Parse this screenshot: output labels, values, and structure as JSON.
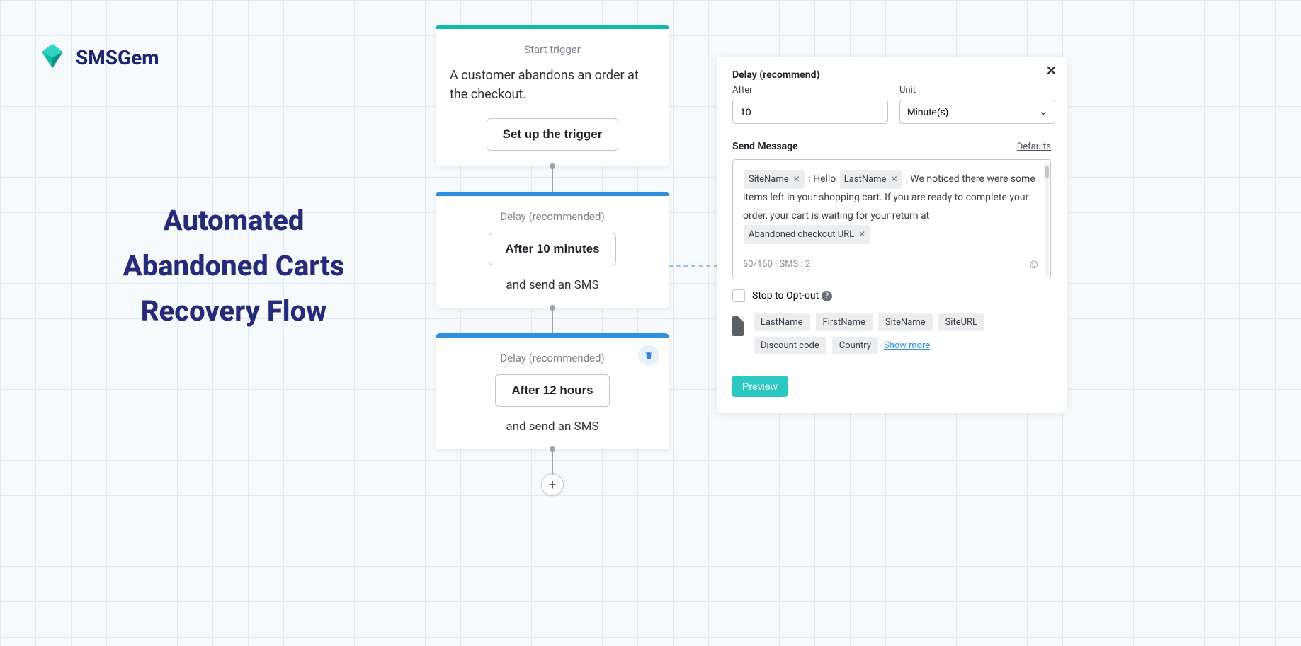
{
  "brand": {
    "name": "SMSGem"
  },
  "headline": {
    "line1": "Automated",
    "line2": "Abandoned Carts",
    "line3": "Recovery Flow"
  },
  "flow": {
    "trigger": {
      "label": "Start trigger",
      "description": "A customer abandons an order at the checkout.",
      "button": "Set up the trigger"
    },
    "delay1": {
      "label": "Delay (recommended)",
      "button": "After 10 minutes",
      "action": "and send an SMS"
    },
    "delay2": {
      "label": "Delay (recommended)",
      "button": "After 12 hours",
      "action": "and send an SMS"
    }
  },
  "panel": {
    "delay_title": "Delay (recommend)",
    "after_label": "After",
    "after_value": "10",
    "unit_label": "Unit",
    "unit_value": "Minute(s)",
    "send_title": "Send Message",
    "defaults": "Defaults",
    "msg": {
      "tag_site": "SiteName",
      "sep1": ": Hello",
      "tag_last": "LastName",
      "body1": ", We noticed there were some items left in your shopping cart. If you are ready to complete your order, your cart is waiting for your return at",
      "tag_url": "Abandoned checkout URL"
    },
    "counter": "60/160  |  SMS : 2",
    "optout": "Stop to Opt-out",
    "chips": {
      "lastname": "LastName",
      "firstname": "FirstName",
      "sitename": "SiteName",
      "siteurl": "SiteURL",
      "discount": "Discount code",
      "country": "Country"
    },
    "show_more": "Show more",
    "preview": "Preview"
  }
}
